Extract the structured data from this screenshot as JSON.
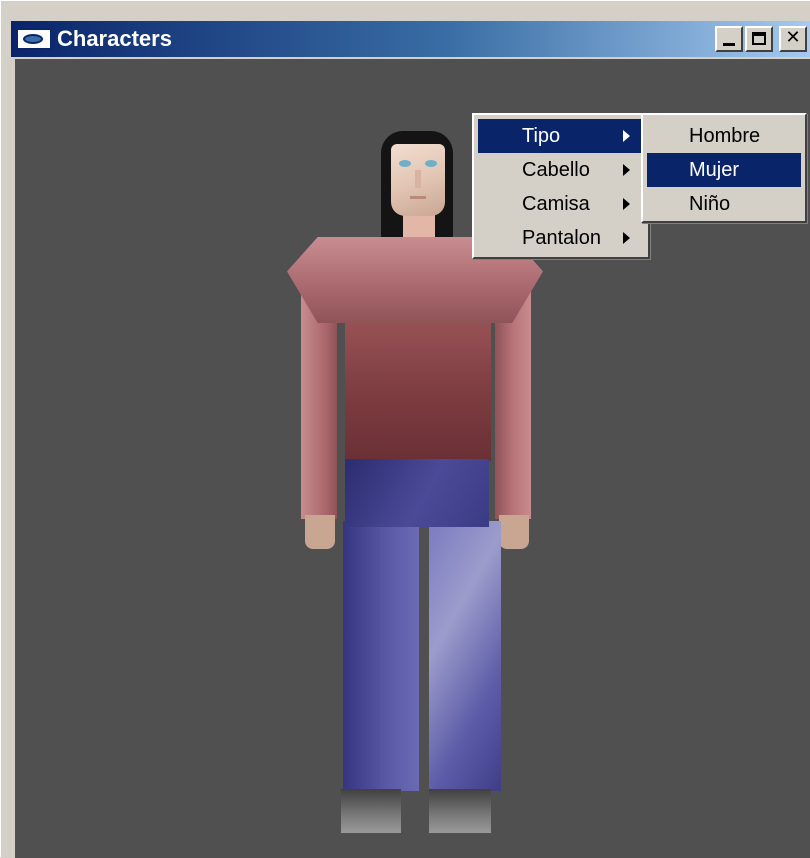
{
  "window": {
    "title": "Characters",
    "icons": {
      "app": "app-icon",
      "minimize": "minimize-icon",
      "maximize": "maximize-icon",
      "close": "close-icon"
    },
    "close_glyph": "✕"
  },
  "menu": {
    "items": [
      {
        "label": "Tipo",
        "has_submenu": true,
        "highlighted": true
      },
      {
        "label": "Cabello",
        "has_submenu": true,
        "highlighted": false
      },
      {
        "label": "Camisa",
        "has_submenu": true,
        "highlighted": false
      },
      {
        "label": "Pantalon",
        "has_submenu": true,
        "highlighted": false
      }
    ]
  },
  "submenu": {
    "parent": "Tipo",
    "items": [
      {
        "label": "Hombre",
        "highlighted": false
      },
      {
        "label": "Mujer",
        "highlighted": true
      },
      {
        "label": "Niño",
        "highlighted": false
      }
    ]
  },
  "colors": {
    "titlebar_start": "#0a246a",
    "titlebar_end": "#a6caf0",
    "viewport_background": "#505050",
    "menu_background": "#d4d0c8",
    "highlight": "#0a246a"
  }
}
